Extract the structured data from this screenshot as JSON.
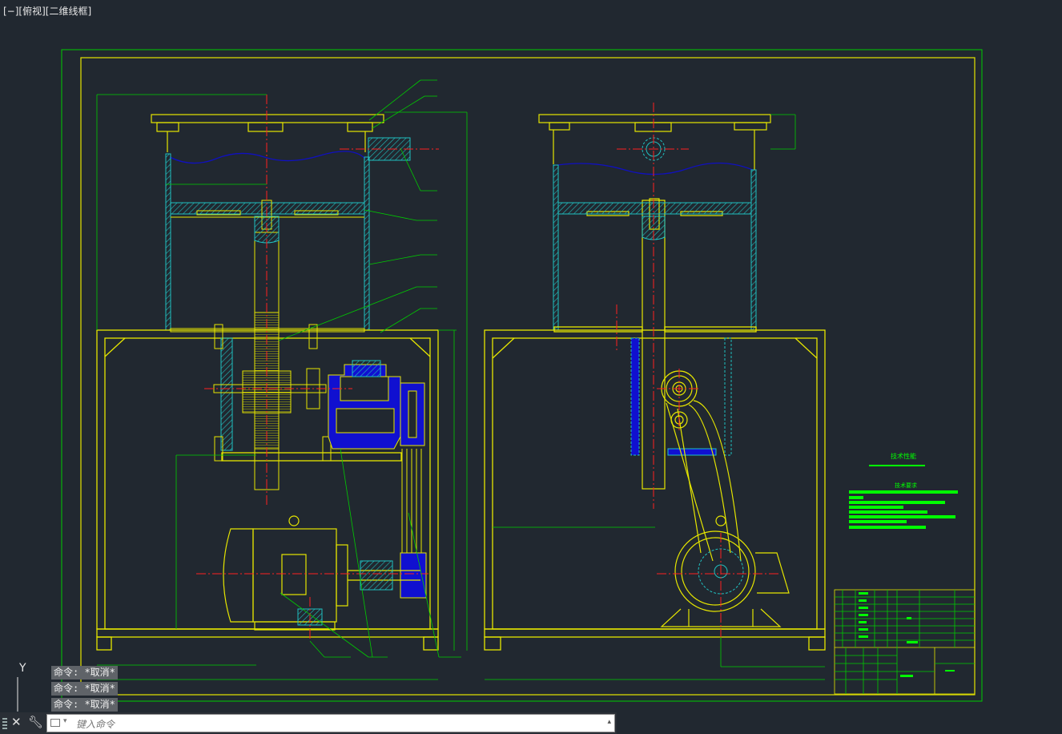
{
  "viewport": {
    "label": "[−][俯视][二维线框]"
  },
  "command_history": [
    "命令: *取消*",
    "命令: *取消*",
    "命令: *取消*"
  ],
  "command_line": {
    "placeholder": "键入命令"
  },
  "ucs": {
    "y_label": "Y"
  },
  "drawing": {
    "tech_title": "技术性能",
    "tech_req_title": "技术要求"
  },
  "colors": {
    "background": "#212830",
    "frame": "#00cc00",
    "outline": "#e6e600",
    "centerline": "#ff2020",
    "hatch": "#20c0c0",
    "solid_fill": "#1010d0",
    "break_line": "#1010c0"
  }
}
